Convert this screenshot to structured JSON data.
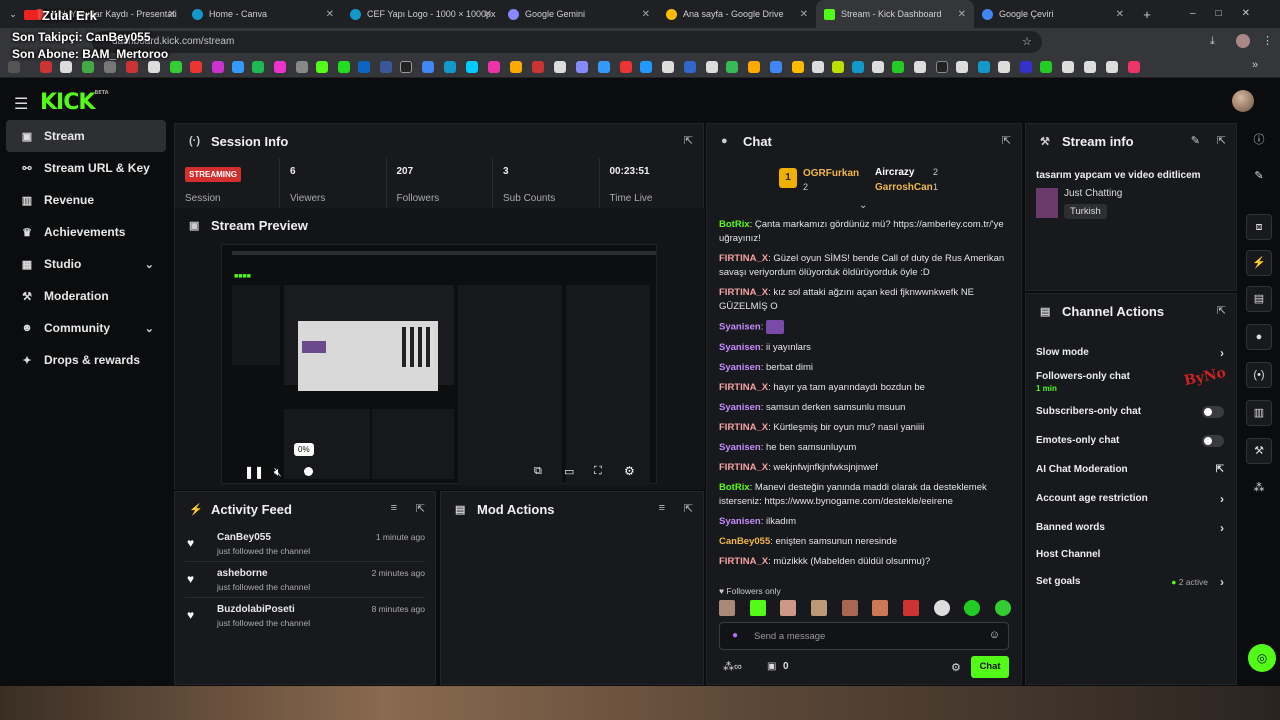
{
  "browser": {
    "tabs": [
      {
        "label": "Kick Yayınlar Kaydı - Presentati",
        "color": "#e44"
      },
      {
        "label": "Home - Canva",
        "color": "#19c"
      },
      {
        "label": "CEF Yapı Logo - 1000 × 1000px",
        "color": "#19c"
      },
      {
        "label": "Google Gemini",
        "color": "#88f"
      },
      {
        "label": "Ana sayfa - Google Drive",
        "color": "#fb0"
      },
      {
        "label": "Stream - Kick Dashboard",
        "color": "#53fc18"
      },
      {
        "label": "Google Çeviri",
        "color": "#4285f4"
      }
    ],
    "url": "dashboard.kick.com/stream"
  },
  "overlay": {
    "name": "Zülal Erk",
    "follower": "Son Takipçi: CanBey055",
    "subscriber": "Son Abone: BAM_Mertoroo"
  },
  "logo": {
    "text": "KICK",
    "sup": "BETA"
  },
  "sidebar": {
    "items": [
      {
        "label": "Stream",
        "icon": "broadcast-icon"
      },
      {
        "label": "Stream URL & Key",
        "icon": "link-icon"
      },
      {
        "label": "Revenue",
        "icon": "chart-icon"
      },
      {
        "label": "Achievements",
        "icon": "trophy-icon"
      },
      {
        "label": "Studio",
        "icon": "grid-icon"
      },
      {
        "label": "Moderation",
        "icon": "wrench-icon"
      },
      {
        "label": "Community",
        "icon": "people-icon"
      },
      {
        "label": "Drops & rewards",
        "icon": "gift-icon"
      }
    ]
  },
  "session": {
    "title": "Session Info",
    "status": "STREAMING",
    "status_label": "Session",
    "stats": [
      {
        "value": "6",
        "label": "Viewers"
      },
      {
        "value": "207",
        "label": "Followers"
      },
      {
        "value": "3",
        "label": "Sub Counts"
      },
      {
        "value": "00:23:51",
        "label": "Time Live"
      }
    ]
  },
  "preview": {
    "title": "Stream Preview",
    "volume": "0%"
  },
  "activity": {
    "title": "Activity Feed",
    "items": [
      {
        "name": "CanBey055",
        "desc": "just followed the channel",
        "time": "1 minute ago"
      },
      {
        "name": "asheborne",
        "desc": "just followed the channel",
        "time": "2 minutes ago"
      },
      {
        "name": "BuzdolabiPoseti",
        "desc": "just followed the channel",
        "time": "8 minutes ago"
      }
    ]
  },
  "mod": {
    "title": "Mod Actions"
  },
  "chat": {
    "title": "Chat",
    "top": [
      {
        "name": "OGRFurkan",
        "count": "2"
      },
      {
        "name": "Aircrazy",
        "count": "2"
      },
      {
        "name": "GarroshCan",
        "count": "1"
      }
    ],
    "messages": [
      {
        "user": "BotRix",
        "color": "#53fc18",
        "text": "Çanta markamızı gördünüz mü? https://amberley.com.tr/'ye uğrayınız!"
      },
      {
        "user": "FIRTINA_X",
        "color": "#f5a3a3",
        "text": "Güzel oyun SİMS! bende Call of duty de Rus Amerikan savaşı veriyordum ölüyorduk öldürüyorduk öyle :D"
      },
      {
        "user": "FIRTINA_X",
        "color": "#f5a3a3",
        "text": "kız sol attaki ağzını açan kedi fjknwwnkwefk NE GÜZELMİŞ O"
      },
      {
        "user": "Syanisen",
        "color": "#c58bff",
        "text": ""
      },
      {
        "user": "Syanisen",
        "color": "#c58bff",
        "text": "ii yayınlars"
      },
      {
        "user": "Syanisen",
        "color": "#c58bff",
        "text": "berbat dimi"
      },
      {
        "user": "FIRTINA_X",
        "color": "#f5a3a3",
        "text": "hayır ya tam ayarındaydı bozdun be"
      },
      {
        "user": "Syanisen",
        "color": "#c58bff",
        "text": "samsun derken samsunlu msuun"
      },
      {
        "user": "FIRTINA_X",
        "color": "#f5a3a3",
        "text": "Kürtleşmiş bir oyun mu? nasıl yaniiii"
      },
      {
        "user": "Syanisen",
        "color": "#c58bff",
        "text": "he ben samsunluyum"
      },
      {
        "user": "FIRTINA_X",
        "color": "#f5a3a3",
        "text": "wekjnfwjnfkjnfwksjnjnwef"
      },
      {
        "user": "BotRix",
        "color": "#53fc18",
        "text": "Manevi desteğin yanında maddi olarak da desteklemek isterseniz: https://www.bynogame.com/destekle/eeirene"
      },
      {
        "user": "Syanisen",
        "color": "#c58bff",
        "text": "ilkadım"
      },
      {
        "user": "CanBey055",
        "color": "#f0b84a",
        "text": "enişten samsunun neresinde"
      },
      {
        "user": "FIRTINA_X",
        "color": "#f5a3a3",
        "text": "müzikkk (Mabelden düldül olsunmu)?"
      }
    ],
    "followers_only": "Followers only",
    "placeholder": "Send a message",
    "points": "0",
    "send": "Chat"
  },
  "stream_info": {
    "title": "Stream info",
    "stream_title": "tasarım yapcam ve video editlicem",
    "category": "Just Chatting",
    "language": "Turkish"
  },
  "channel_actions": {
    "title": "Channel Actions",
    "items": [
      {
        "label": "Slow mode",
        "kind": "arrow"
      },
      {
        "label": "Followers-only chat",
        "sub": "1 min",
        "kind": "none"
      },
      {
        "label": "Subscribers-only chat",
        "kind": "toggle"
      },
      {
        "label": "Emotes-only chat",
        "kind": "toggle"
      },
      {
        "label": "AI Chat Moderation",
        "kind": "external"
      },
      {
        "label": "Account age restriction",
        "kind": "arrow"
      },
      {
        "label": "Banned words",
        "kind": "arrow"
      },
      {
        "label": "Host Channel",
        "kind": "none"
      },
      {
        "label": "Set goals",
        "extra": "2 active",
        "kind": "arrow"
      }
    ]
  }
}
